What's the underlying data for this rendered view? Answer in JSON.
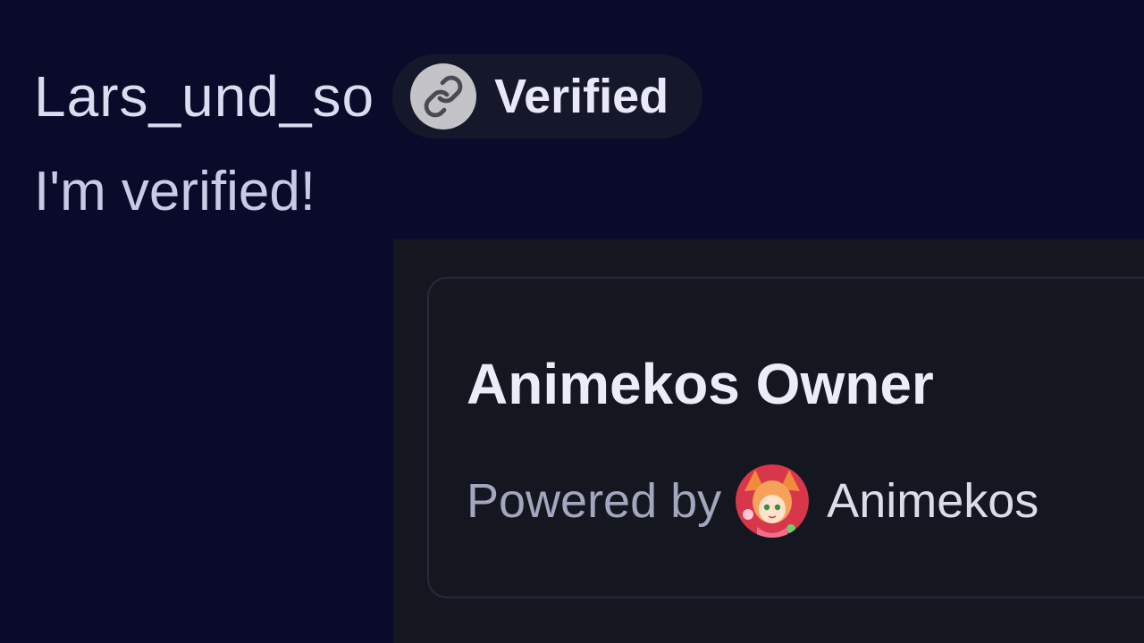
{
  "profile": {
    "username": "Lars_und_so",
    "status_message": "I'm verified!"
  },
  "badge": {
    "icon": "link-icon",
    "label": "Verified"
  },
  "embed": {
    "title": "Animekos Owner",
    "powered_by_label": "Powered by",
    "brand_icon": "anime-avatar-icon",
    "brand_name": "Animekos"
  },
  "colors": {
    "background": "#0a0b2a",
    "embed_panel": "#151720",
    "badge_background": "#15172b",
    "badge_icon_circle": "#c4c4c8",
    "muted_text": "#a3a6bd"
  }
}
